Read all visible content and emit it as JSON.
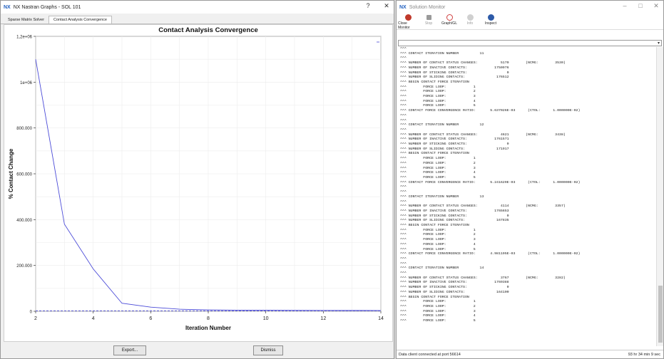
{
  "graphs": {
    "title": "NX Nastran Graphs - SOL 101",
    "logo": "NX",
    "help_glyph": "?",
    "close_glyph": "✕",
    "tabs": [
      "Sparse Matrix Solver",
      "Contact Analysis Convergence"
    ],
    "export_label": "Export...",
    "dismiss_label": "Dismiss"
  },
  "chart_data": {
    "type": "line",
    "title": "Contact Analysis Convergence",
    "xlabel": "Iteration Number",
    "ylabel": "% Contact Change",
    "xlim": [
      2,
      14
    ],
    "ylim": [
      0,
      1200000
    ],
    "x_ticks": [
      "2",
      "4",
      "6",
      "8",
      "10",
      "12",
      "14"
    ],
    "y_ticks": [
      "0",
      "200.000",
      "400.000",
      "600.000",
      "800.000",
      "1e+06",
      "1,2e+06"
    ],
    "grid": true,
    "series": [
      {
        "color": "#4b4bd8",
        "x": [
          2,
          3,
          4,
          5,
          6,
          7,
          8,
          9,
          10,
          11,
          12,
          13,
          14
        ],
        "y": [
          1100000,
          380000,
          185000,
          35000,
          18000,
          9000,
          6000,
          5000,
          4500,
          4000,
          3800,
          3500,
          3400
        ]
      },
      {
        "color": "#4b4bd8",
        "dashed": true,
        "x": [
          2,
          14
        ],
        "y": [
          2000,
          2000
        ]
      }
    ]
  },
  "monitor": {
    "title": "Solution Monitor",
    "logo": "NX",
    "tools": [
      {
        "label": "Close Monitor",
        "icon": "close-monitor-icon",
        "color": "#c0392b",
        "enabled": true
      },
      {
        "label": "Stop",
        "icon": "stop-icon",
        "color": "#9a9a9a",
        "enabled": false
      },
      {
        "label": "Graph/GL",
        "icon": "graph-icon",
        "color": "#d04040",
        "enabled": true
      },
      {
        "label": "Info",
        "icon": "info-icon",
        "color": "#b0b0b0",
        "enabled": false
      },
      {
        "label": "Inspect",
        "icon": "inspect-icon",
        "color": "#2d5aa8",
        "enabled": true
      }
    ],
    "log": "^^^\n^^^ CONTACT ITERATION NUMBER          11\n^^^\n^^^ NUMBER OF CONTACT STATUS CHANGES:           5170        (NCMG:        3530)\n^^^ NUMBER OF INACTIVE CONTACTS:             1750976\n^^^ NUMBER OF STICKING CONTACTS:                   0\n^^^ NUMBER OF SLIDING CONTACTS:               176512\n^^^ BEGIN CONTACT FORCE ITERATION\n^^^        FORCE LOOP:             1\n^^^        FORCE LOOP:             2\n^^^        FORCE LOOP:             3\n^^^        FORCE LOOP:             4\n^^^        FORCE LOOP:             5\n^^^ CONTACT FORCE CONVERGENCE RATIO:       5.637026E-03      (CTOL:      1.000000E-02)\n^^^\n^^^\n^^^ CONTACT ITERATION NUMBER          12\n^^^\n^^^ NUMBER OF CONTACT STATUS CHANGES:           4621        (NCMG:        3438)\n^^^ NUMBER OF INACTIVE CONTACTS:             1761571\n^^^ NUMBER OF STICKING CONTACTS:                   0\n^^^ NUMBER OF SLIDING CONTACTS:               171917\n^^^ BEGIN CONTACT FORCE ITERATION\n^^^        FORCE LOOP:             1\n^^^        FORCE LOOP:             2\n^^^        FORCE LOOP:             3\n^^^        FORCE LOOP:             4\n^^^        FORCE LOOP:             5\n^^^ CONTACT FORCE CONVERGENCE RATIO:       5.241629E-03      (CTOL:      1.000000E-02)\n^^^\n^^^\n^^^ CONTACT ITERATION NUMBER          13\n^^^\n^^^ NUMBER OF CONTACT STATUS CHANGES:           4114        (NCMG:        3357)\n^^^ NUMBER OF INACTIVE CONTACTS:             1765653\n^^^ NUMBER OF STICKING CONTACTS:                   0\n^^^ NUMBER OF SLIDING CONTACTS:               167835\n^^^ BEGIN CONTACT FORCE ITERATION\n^^^        FORCE LOOP:             1\n^^^        FORCE LOOP:             2\n^^^        FORCE LOOP:             3\n^^^        FORCE LOOP:             4\n^^^        FORCE LOOP:             5\n^^^ CONTACT FORCE CONVERGENCE RATIO:       4.981195E-03      (CTOL:      1.000000E-02)\n^^^\n^^^\n^^^ CONTACT ITERATION NUMBER          14\n^^^\n^^^ NUMBER OF CONTACT STATUS CHANGES:           3767        (NCMG:        3282)\n^^^ NUMBER OF INACTIVE CONTACTS:             1769388\n^^^ NUMBER OF STICKING CONTACTS:                   0\n^^^ NUMBER OF SLIDING CONTACTS:               164100\n^^^ BEGIN CONTACT FORCE ITERATION\n^^^        FORCE LOOP:             1\n^^^        FORCE LOOP:             2\n^^^        FORCE LOOP:             3\n^^^        FORCE LOOP:             4\n^^^        FORCE LOOP:             5",
    "status_left": "Data client connected at port 56614",
    "status_right": "93 hr 34 min 9 sec",
    "window_controls": [
      "–",
      "□",
      "✕"
    ]
  }
}
